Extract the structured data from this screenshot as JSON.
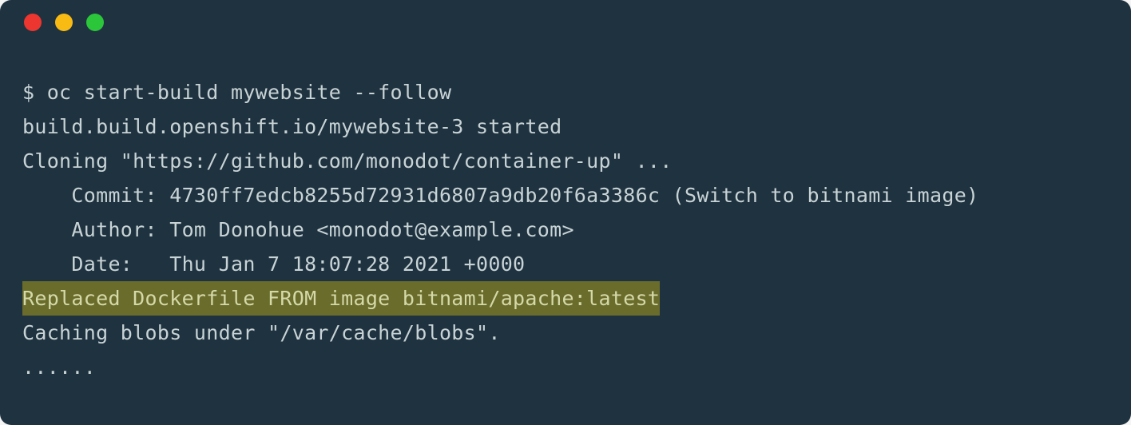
{
  "terminal": {
    "traffic_lights": {
      "red": "#ed362f",
      "yellow": "#f7bb13",
      "green": "#2bc63a"
    },
    "lines": {
      "l1": "$ oc start-build mywebsite --follow",
      "l2": "build.build.openshift.io/mywebsite-3 started",
      "l3": "Cloning \"https://github.com/monodot/container-up\" ...",
      "l4": "    Commit: 4730ff7edcb8255d72931d6807a9db20f6a3386c (Switch to bitnami image)",
      "l5": "    Author: Tom Donohue <monodot@example.com>",
      "l6": "    Date:   Thu Jan 7 18:07:28 2021 +0000",
      "l7": "Replaced Dockerfile FROM image bitnami/apache:latest",
      "l8": "Caching blobs under \"/var/cache/blobs\".",
      "l9": "......"
    },
    "highlight_color": "#6a6c2c"
  }
}
